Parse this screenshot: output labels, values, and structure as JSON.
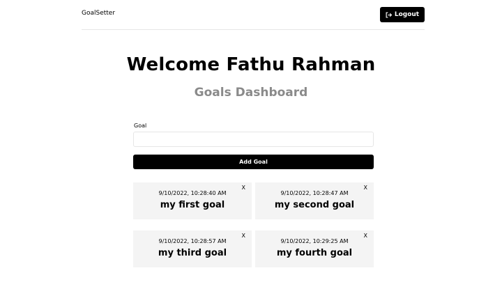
{
  "header": {
    "logo": "GoalSetter",
    "logout_label": "Logout",
    "logout_icon": "sign-out-icon"
  },
  "main": {
    "welcome": "Welcome Fathu Rahman",
    "subtitle": "Goals Dashboard"
  },
  "form": {
    "goal_label": "Goal",
    "goal_value": "",
    "add_label": "Add Goal"
  },
  "goals": [
    {
      "date": "9/10/2022, 10:28:40 AM",
      "text": "my first goal",
      "close": "X"
    },
    {
      "date": "9/10/2022, 10:28:47 AM",
      "text": "my second goal",
      "close": "X"
    },
    {
      "date": "9/10/2022, 10:28:57 AM",
      "text": "my third goal",
      "close": "X"
    },
    {
      "date": "9/10/2022, 10:29:25 AM",
      "text": "my fourth goal",
      "close": "X"
    }
  ]
}
